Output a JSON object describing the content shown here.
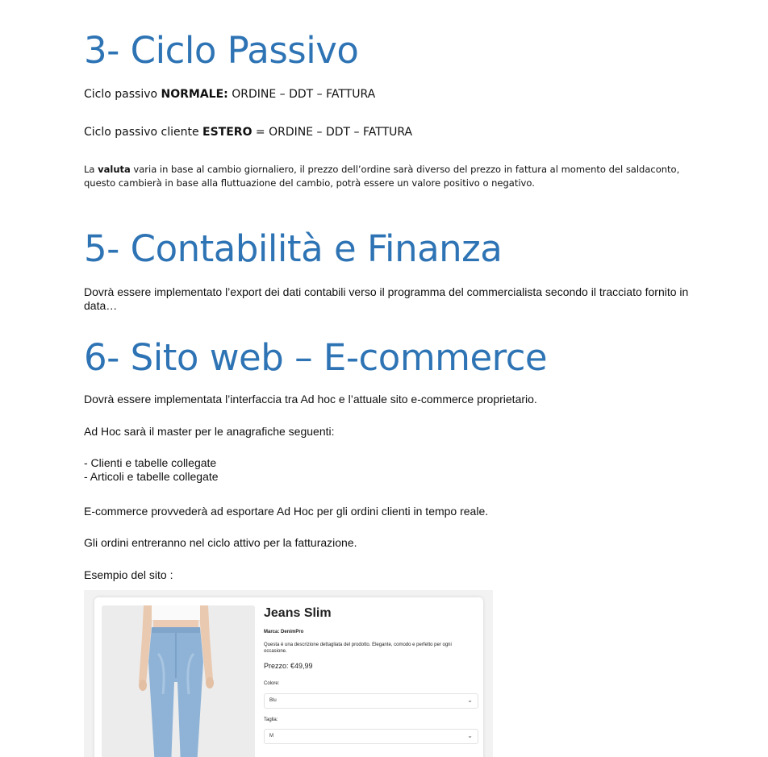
{
  "section3": {
    "title": "3- Ciclo Passivo",
    "line1": {
      "prefix": "Ciclo passivo ",
      "bold": "NORMALE:",
      "suffix": " ORDINE – DDT – FATTURA"
    },
    "line2": {
      "prefix": "Ciclo passivo cliente ",
      "bold": "ESTERO",
      "suffix": " = ORDINE – DDT – FATTURA"
    },
    "valuta": {
      "prefix": "La ",
      "bold": "valuta",
      "rest": " varia in base al cambio giornaliero, il prezzo dell’ordine sarà diverso del prezzo in fattura al momento del saldaconto, questo cambierà in base alla fluttuazione del cambio, potrà essere un valore positivo o negativo."
    }
  },
  "section5": {
    "title": "5- Contabilità e Finanza",
    "paragraph": "Dovrà essere implementato l’export dei dati contabili verso il programma del commercialista secondo il tracciato fornito in data…"
  },
  "section6": {
    "title": "6- Sito web – E-commerce",
    "p1": "Dovrà essere implementata l’interfaccia tra Ad hoc e l’attuale sito e-commerce proprietario.",
    "p2": "Ad Hoc sarà il master per le anagrafiche seguenti:",
    "list": [
      "- Clienti e tabelle collegate",
      "- Articoli e tabelle collegate"
    ],
    "p3": "E-commerce provvederà ad esportare Ad Hoc per gli ordini clienti in tempo reale.",
    "p4": "Gli ordini entreranno nel ciclo attivo per la fatturazione.",
    "p5": "Esempio del sito :"
  },
  "product": {
    "title": "Jeans Slim",
    "brand": "Marca: DenimPro",
    "description": "Questa è una descrizione dettagliata del prodotto. Elegante, comodo e perfetto per ogni occasione.",
    "price": "Prezzo: €49,99",
    "color_label": "Colore:",
    "color_value": "Blu",
    "size_label": "Taglia:",
    "size_value": "M"
  }
}
